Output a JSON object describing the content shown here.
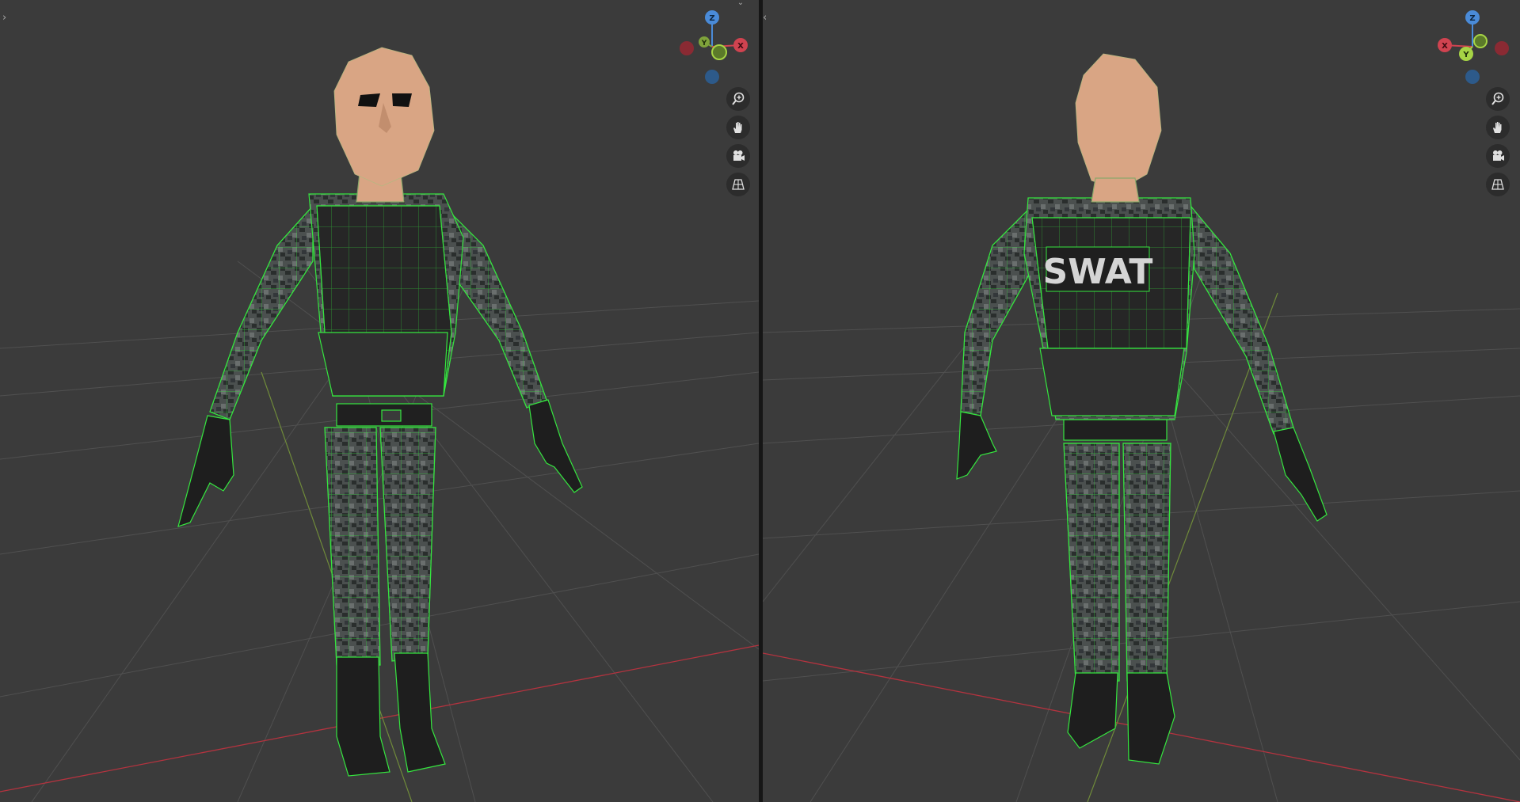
{
  "colors": {
    "viewport_bg": "#3b3b3b",
    "grid_line": "#505050",
    "x_axis": "#b4333f",
    "y_axis": "#6f8a3a",
    "wire": "#35e63f",
    "skin": "#d9a584",
    "camo_dark": "#2b2f2e",
    "camo_mid": "#545958",
    "vest": "#282828"
  },
  "viewports": [
    {
      "name": "front-view",
      "gizmo": {
        "z": "Z",
        "y": "Y",
        "x": "X"
      },
      "nav": [
        "zoom-icon",
        "hand-pan-icon",
        "camera-icon",
        "grid-perspective-icon"
      ]
    },
    {
      "name": "back-view",
      "vest_label": "SWAT",
      "gizmo": {
        "z": "Z",
        "y": "Y",
        "x": "X"
      },
      "nav": [
        "zoom-icon",
        "hand-pan-icon",
        "camera-icon",
        "grid-perspective-icon"
      ]
    }
  ]
}
